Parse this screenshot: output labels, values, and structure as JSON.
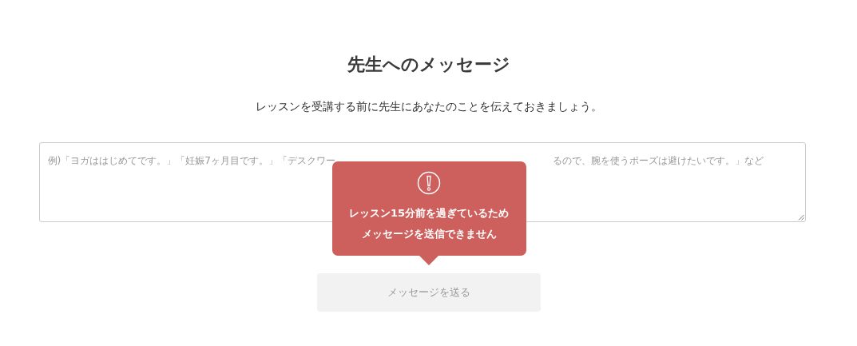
{
  "title": "先生へのメッセージ",
  "subtitle": "レッスンを受講する前に先生にあなたのことを伝えておきましょう。",
  "message_field": {
    "placeholder_parts": [
      "例)「ヨガははじめてです。」「妊娠7ヶ月目です。」「デスクワー",
      "るので、腕を使うポーズは避けたいです。」など"
    ]
  },
  "warning_tooltip": {
    "lines": [
      "レッスン15分前を過ぎているため",
      "メッセージを送信できません"
    ]
  },
  "send_button": {
    "label": "メッセージを送る",
    "disabled": true
  }
}
